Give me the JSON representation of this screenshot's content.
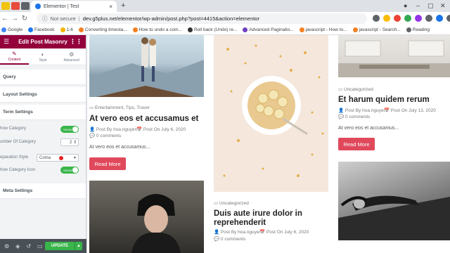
{
  "browser": {
    "tab_title": "Elementor | Test",
    "new_tab": "+",
    "close": "×",
    "url_notice": "Not secure",
    "url": "dev.g5plus.net/elementor/wp-admin/post.php?post=4415&action=elementor",
    "bookmarks": [
      {
        "label": "Google",
        "color": "#4285f4"
      },
      {
        "label": "Facebook",
        "color": "#1877f2"
      },
      {
        "label": "1-6",
        "color": "#f4b400"
      },
      {
        "label": "Converting timesta...",
        "color": "#f48024"
      },
      {
        "label": "How to undo a com...",
        "color": "#f48024"
      },
      {
        "label": "Roll back (Undo) re...",
        "color": "#333333"
      },
      {
        "label": "Advanced Paginatio...",
        "color": "#6f42c1"
      },
      {
        "label": "javascript - How to...",
        "color": "#f48024"
      },
      {
        "label": "javascript - Search...",
        "color": "#f48024"
      },
      {
        "label": "Reading",
        "color": "#5f6368"
      }
    ]
  },
  "panel": {
    "title": "Edit Post Masonry",
    "tabs": [
      {
        "label": "Content",
        "icon": "pencil-icon"
      },
      {
        "label": "Style",
        "icon": "half-circle-icon"
      },
      {
        "label": "Advanced",
        "icon": "gear-icon"
      }
    ],
    "sections": {
      "query": "Query",
      "layout": "Layout Settings",
      "term": "Term Settings",
      "meta": "Meta Settings"
    },
    "controls": {
      "show_category": "how Category",
      "show_category_state": "SHOW",
      "number_category": "umber Of Category",
      "number_category_value": "2",
      "separation_style": "eparation Style",
      "separation_value": "Coma",
      "show_category_icon": "how Category Icon",
      "show_category_icon_state": "SHOW"
    },
    "update_label": "UPDATE"
  },
  "posts": {
    "col1": {
      "terms": "Entertainment, Tips, Traver",
      "title": "At vero eos et accusamus et",
      "author": "Post By hoa.nguyen",
      "date": "Post On July 6, 2020",
      "comments": "0 comments",
      "excerpt": "At vero eos et accusamus...",
      "button": "Read More"
    },
    "col2": {
      "terms": "Uncategorized",
      "title": "Duis aute irure dolor in reprehenderit",
      "author": "Post By hoa.nguyen",
      "date": "Post On July 6, 2020",
      "comments": "0 comments"
    },
    "col3": {
      "terms": "Uncategorized",
      "title": "Et harum quidem rerum",
      "author": "Post By hoa.nguyen",
      "date": "Post On July 13, 2020",
      "comments": "0 comments",
      "excerpt": "At vero eos et accusamus...",
      "button": "Read More"
    }
  },
  "colors": {
    "elementor": "#93003c",
    "update": "#39b54a",
    "read_more": "#e0495c"
  }
}
